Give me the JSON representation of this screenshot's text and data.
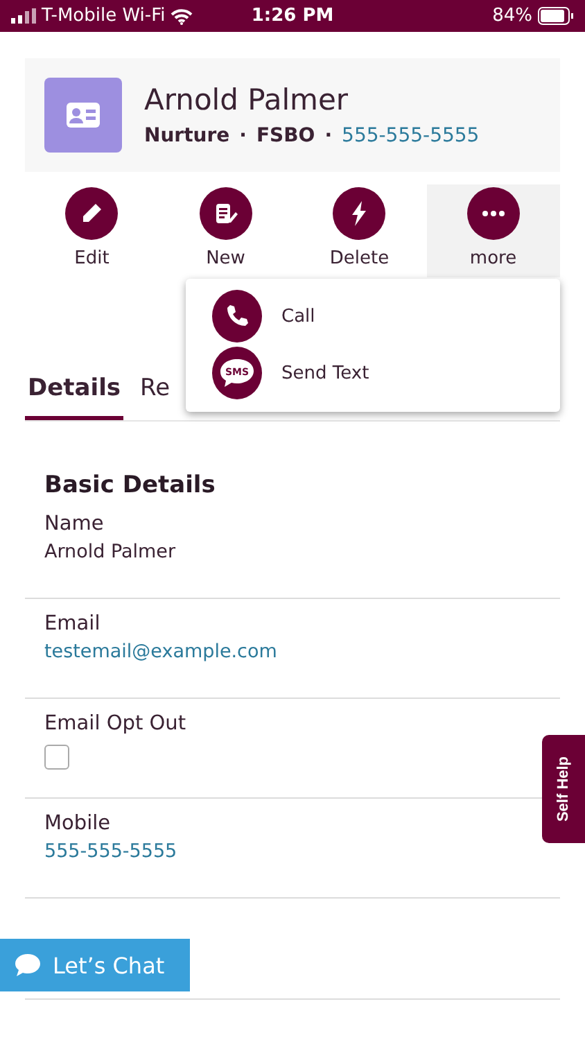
{
  "status_bar": {
    "carrier": "T-Mobile Wi-Fi",
    "time": "1:26 PM",
    "battery": "84%"
  },
  "contact": {
    "name": "Arnold Palmer",
    "status": "Nurture",
    "source": "FSBO",
    "separator": "·",
    "phone": "555-555-5555"
  },
  "actions": [
    {
      "label": "Edit",
      "kind": "edit",
      "selected": false
    },
    {
      "label": "New",
      "kind": "new",
      "selected": false
    },
    {
      "label": "Delete",
      "kind": "delete",
      "selected": false
    },
    {
      "label": "more",
      "kind": "more",
      "selected": true
    }
  ],
  "menu": [
    {
      "label": "Call",
      "kind": "call"
    },
    {
      "label": "Send Text",
      "kind": "sms",
      "icon_text": "SMS"
    }
  ],
  "tabs": [
    {
      "label": "Details",
      "selected": true
    },
    {
      "label": "Re",
      "selected": false
    }
  ],
  "section_title": "Basic Details",
  "fields": [
    {
      "kind": "text",
      "label": "Name",
      "value": "Arnold Palmer"
    },
    {
      "kind": "link",
      "label": "Email",
      "value": "testemail@example.com"
    },
    {
      "kind": "checkbox",
      "label": "Email Opt Out",
      "checked": false
    },
    {
      "kind": "link",
      "label": "Mobile",
      "value": "555-555-5555"
    }
  ],
  "self_help": "Self Help",
  "chat_button": "Let’s Chat"
}
